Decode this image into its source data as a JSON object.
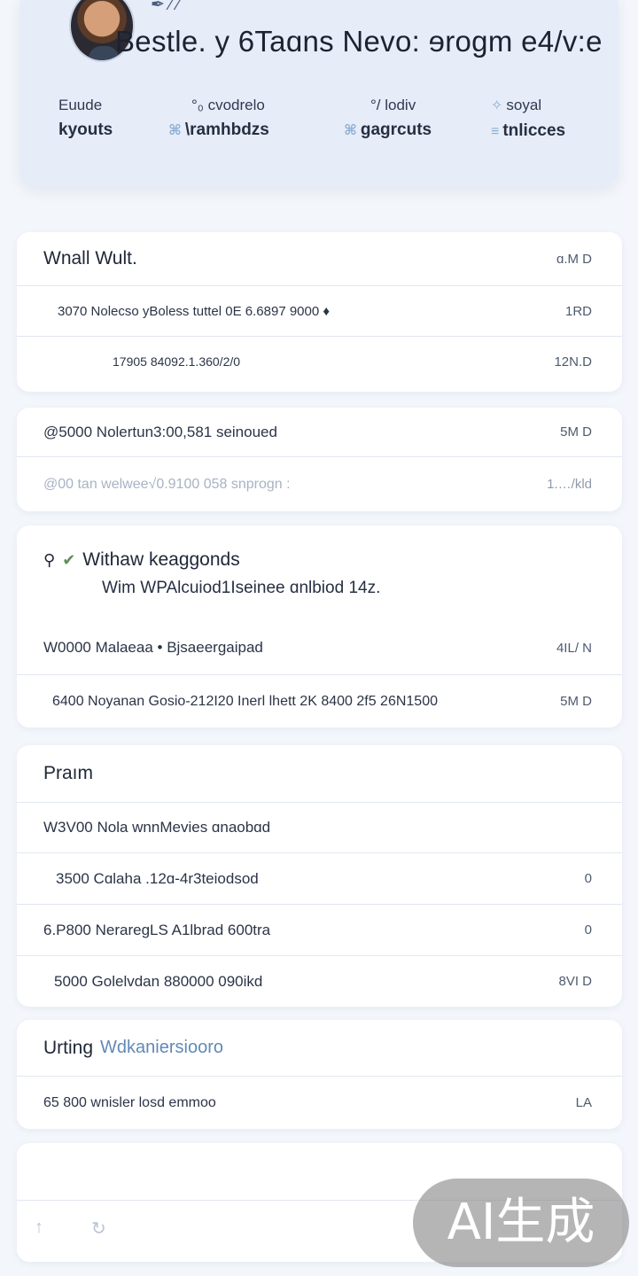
{
  "header": {
    "title": "Bestle. y 6Taɑns Nevo: ɘrogm e4/v:e",
    "pen_icon": "pen-icon",
    "stats": [
      {
        "label": "Euude",
        "value": "kyouts"
      },
      {
        "label": "°₀ cvodrelo",
        "value": "\\ramhbdzs"
      },
      {
        "label": "°/ lodiv",
        "value": "gagrcuts"
      },
      {
        "label": "soyal",
        "value": "tnlicces"
      }
    ]
  },
  "card1": {
    "title": "Wnall Wult.",
    "title_value": "ɑ.M D",
    "rows": [
      {
        "text": "3070 Nolecso yBoless tuttel 0E 6.6897 9000 ♦",
        "value": "1RD"
      },
      {
        "text": "17905 84092.1.360/2/0",
        "value": "12N.D"
      }
    ]
  },
  "card2": {
    "rows": [
      {
        "text": "@5000 Nolertun3:00,581 seinoued",
        "value": "5M D"
      },
      {
        "text": "@00 tan welwee√0.9100 058 snprogn :",
        "value": "1.…/kld"
      }
    ]
  },
  "card3": {
    "title": "Withaw keaggonds",
    "subtitle": "Wim WPAlcuiod1Iseinee ɑnlbiod 14z.",
    "rows": [
      {
        "text": "W0000 Malaeaa • Bjsaeergaipad",
        "value": "4IL/ N"
      },
      {
        "text": "6400 Noyanan Gosio-212I20 Inerl lhett 2K 8400 2f5 26N1500",
        "value": "5M D"
      }
    ]
  },
  "card4": {
    "title": "Praım",
    "rows": [
      {
        "text": "W3V00 Nola wnnMevies ɑnaobɑd",
        "value": ""
      },
      {
        "text": "3500 Cɑlaha .12ɑ-4r3teiodsod",
        "value": "0"
      },
      {
        "text": "6.P800 NeraregLS A1lbrad 600tra",
        "value": "0"
      },
      {
        "text": "5000 Golelvdan 880000 090ikd",
        "value": "8VI D"
      }
    ]
  },
  "card5": {
    "title": "Urting",
    "title_accent": "Wdkaniersiooro",
    "rows": [
      {
        "text": "65 800 wnisler losd emmoo",
        "value": "LA"
      }
    ]
  },
  "card6": {
    "icons": [
      "up-arrow-icon",
      "refresh-icon"
    ]
  },
  "watermark": {
    "text": "AI生成"
  }
}
